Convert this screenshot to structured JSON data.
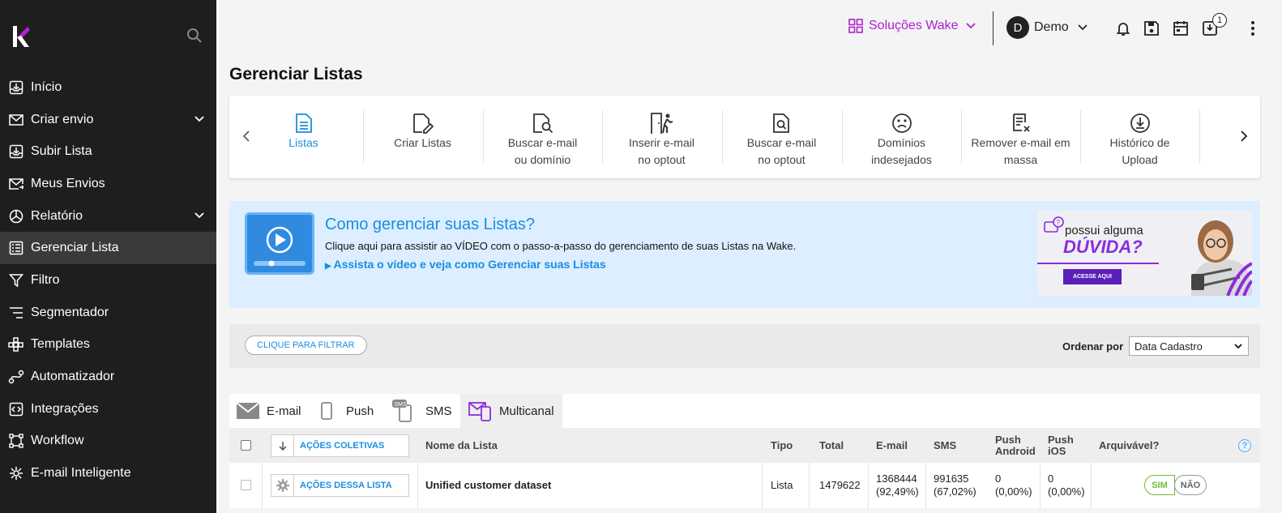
{
  "sidebar": {
    "items": [
      {
        "label": "Início",
        "icon": "inbox-arrow-icon"
      },
      {
        "label": "Criar envio",
        "icon": "envelope-icon",
        "expandable": true
      },
      {
        "label": "Subir Lista",
        "icon": "upload-tray-icon"
      },
      {
        "label": "Meus Envios",
        "icon": "envelope-send-icon"
      },
      {
        "label": "Relatório",
        "icon": "pie-chart-icon",
        "expandable": true
      },
      {
        "label": "Gerenciar Lista",
        "icon": "list-icon",
        "active": true
      },
      {
        "label": "Filtro",
        "icon": "funnel-icon"
      },
      {
        "label": "Segmentador",
        "icon": "segment-lines-icon"
      },
      {
        "label": "Templates",
        "icon": "grid-template-icon"
      },
      {
        "label": "Automatizador",
        "icon": "flow-icon"
      },
      {
        "label": "Integrações",
        "icon": "code-box-icon"
      },
      {
        "label": "Workflow",
        "icon": "workflow-icon"
      },
      {
        "label": "E-mail Inteligente",
        "icon": "brain-icon"
      }
    ]
  },
  "topbar": {
    "solucoes_label": "Soluções Wake",
    "user_initial": "D",
    "user_name": "Demo",
    "download_badge": "1",
    "brand_color": "#b020d0"
  },
  "page_title": "Gerenciar Listas",
  "toolbar": {
    "items": [
      {
        "line1": "Listas",
        "line2": "",
        "icon": "document-list-icon",
        "active": true
      },
      {
        "line1": "Criar Listas",
        "line2": "",
        "icon": "document-edit-icon"
      },
      {
        "line1": "Buscar e-mail",
        "line2": "ou domínio",
        "icon": "document-search-icon"
      },
      {
        "line1": "Inserir e-mail",
        "line2": "no optout",
        "icon": "door-person-icon"
      },
      {
        "line1": "Buscar e-mail",
        "line2": "no optout",
        "icon": "document-search-optout-icon"
      },
      {
        "line1": "Domínios",
        "line2": "indesejados",
        "icon": "sad-face-icon"
      },
      {
        "line1": "Remover e-mail em",
        "line2": "massa",
        "icon": "document-remove-icon"
      },
      {
        "line1": "Histórico de",
        "line2": "Upload",
        "icon": "download-circle-icon"
      }
    ]
  },
  "banner": {
    "title": "Como gerenciar suas Listas?",
    "description": "Clique aqui para assistir ao VÍDEO com o passo-a-passo do gerenciamento de suas Listas na Wake.",
    "link": "Assista o vídeo e veja como Gerenciar suas Listas",
    "promo_line1": "possui alguma",
    "promo_line2": "DÚVIDA?",
    "promo_button": "ACESSE AQUI"
  },
  "filter": {
    "button_label": "CLIQUE PARA FILTRAR",
    "order_label": "Ordenar por",
    "order_value": "Data Cadastro"
  },
  "tabs": [
    {
      "label": "E-mail",
      "icon": "email-envelope-icon"
    },
    {
      "label": "Push",
      "icon": "phone-icon"
    },
    {
      "label": "SMS",
      "icon": "sms-phone-icon"
    },
    {
      "label": "Multicanal",
      "icon": "multichannel-icon",
      "active": true
    }
  ],
  "table": {
    "bulk_actions_label": "AÇÕES COLETIVAS",
    "headers": {
      "name": "Nome da Lista",
      "tipo": "Tipo",
      "total": "Total",
      "email": "E-mail",
      "sms": "SMS",
      "push_android_1": "Push",
      "push_android_2": "Android",
      "push_ios_1": "Push",
      "push_ios_2": "iOS",
      "arquivavel": "Arquivável?",
      "help": "?"
    },
    "rows": [
      {
        "actions_label": "AÇÕES DESSA LISTA",
        "name": "Unified customer dataset",
        "tipo": "Lista",
        "total": "1479622",
        "email_count": "1368444",
        "email_pct": "(92,49%)",
        "sms_count": "991635",
        "sms_pct": "(67,02%)",
        "android_count": "0",
        "android_pct": "(0,00%)",
        "ios_count": "0",
        "ios_pct": "(0,00%)",
        "sim": "SIM",
        "nao": "NÃO"
      }
    ]
  }
}
